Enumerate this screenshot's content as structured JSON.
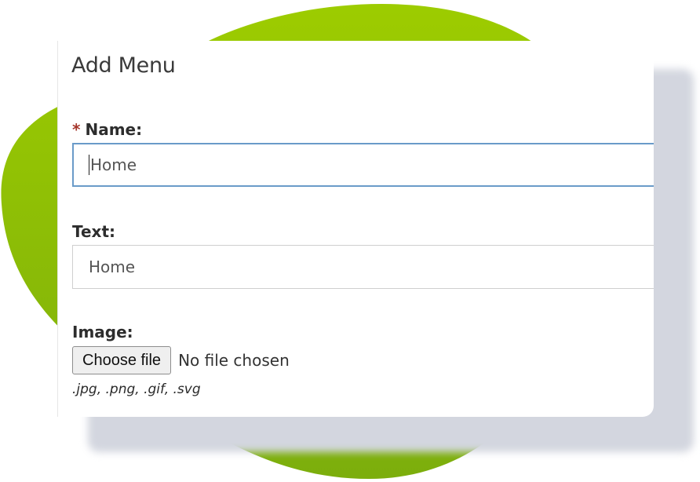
{
  "form": {
    "title": "Add Menu",
    "name": {
      "required_mark": "*",
      "label": "Name:",
      "value": "Home"
    },
    "text": {
      "label": "Text:",
      "value": "Home"
    },
    "image": {
      "label": "Image:",
      "button_label": "Choose file",
      "status": "No file chosen",
      "hint": ".jpg, .png, .gif, .svg"
    }
  },
  "colors": {
    "blob": "#97c703",
    "blob_dark": "#7aad0e",
    "required": "#a5362b",
    "focus_border": "#6a9bc9"
  }
}
